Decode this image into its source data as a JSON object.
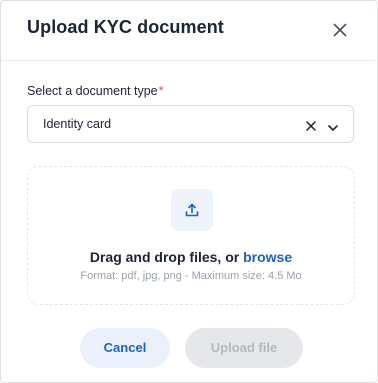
{
  "modal": {
    "title": "Upload KYC document"
  },
  "document_type": {
    "label": "Select a document type",
    "required_marker": "*",
    "selected_value": "Identity card"
  },
  "dropzone": {
    "text": "Drag and drop files, or",
    "browse_label": "browse",
    "format_hint": "Format: pdf, jpg, png - Maximum size: 4.5 Mo"
  },
  "footer": {
    "cancel_label": "Cancel",
    "upload_label": "Upload file"
  },
  "colors": {
    "accent": "#1f5fc8",
    "required": "#e5484d",
    "disabled_bg": "#e6e7ea",
    "disabled_text": "#b3b8bf"
  },
  "icons": {
    "close": "close-icon",
    "clear": "clear-icon",
    "dropdown": "chevron-down-icon",
    "upload": "upload-icon"
  },
  "state": {
    "upload_enabled": false
  }
}
